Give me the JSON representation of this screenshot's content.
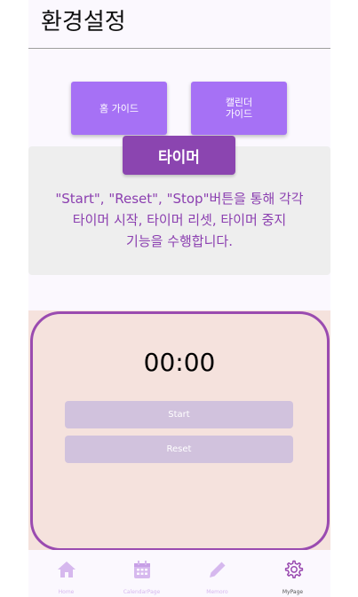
{
  "header": {
    "title": "환경설정"
  },
  "guides": {
    "home_label": "홈 가이드",
    "calendar_label": "캘린더\n가이드"
  },
  "description": {
    "tag": "타이머",
    "text": "\"Start\", \"Reset\", \"Stop\"버튼을 통해 각각\n타이머 시작, 타이머 리셋, 타이머 중지\n기능을 수행합니다."
  },
  "timer": {
    "display": "00:00",
    "start_label": "Start",
    "reset_label": "Reset"
  },
  "nav": {
    "items": [
      {
        "label": "Home",
        "icon": "home-icon"
      },
      {
        "label": "CalendarPage",
        "icon": "calendar-icon"
      },
      {
        "label": "Memoro",
        "icon": "pencil-icon"
      },
      {
        "label": "MyPage",
        "icon": "gear-icon"
      }
    ],
    "active_index": 3
  },
  "colors": {
    "accent": "#a671f5",
    "tag": "#8b45b0",
    "timer_border": "#9a4bb0",
    "timer_bg": "#f5e2dd",
    "nav_inactive": "#d6b8ee"
  }
}
